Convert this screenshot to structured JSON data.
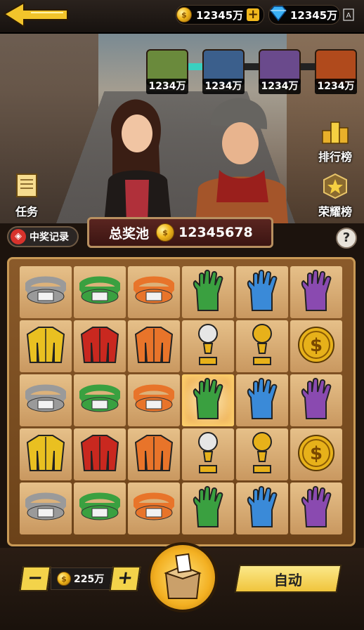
{
  "top_bar": {
    "coins": "12345万",
    "diamonds": "12345万"
  },
  "chests": [
    {
      "color": "#6a8a3c",
      "label": "1234万"
    },
    {
      "color": "#3b5f8c",
      "label": "1234万"
    },
    {
      "color": "#6a4a8c",
      "label": "1234万"
    },
    {
      "color": "#b04a1c",
      "label": "1234万"
    }
  ],
  "side_buttons": {
    "task": "任务",
    "ranking": "排行榜",
    "honor": "荣耀榜"
  },
  "prize": {
    "record_label": "中奖记录",
    "pool_label": "总奖池",
    "pool_value": "12345678",
    "help": "?"
  },
  "board": {
    "items": [
      [
        "gray-belt",
        "green-belt",
        "orange-belt",
        "green-glove",
        "blue-glove",
        "purple-glove"
      ],
      [
        "yellow-jacket",
        "red-jacket",
        "orange-jacket",
        "silver-trophy",
        "gold-trophy",
        "gold-coin"
      ],
      [
        "gray-belt",
        "green-belt",
        "orange-belt",
        "green-glove",
        "blue-glove",
        "purple-glove"
      ],
      [
        "yellow-jacket",
        "red-jacket",
        "orange-jacket",
        "silver-trophy",
        "gold-trophy",
        "gold-coin"
      ],
      [
        "gray-belt",
        "green-belt",
        "orange-belt",
        "green-glove",
        "blue-glove",
        "purple-glove"
      ]
    ],
    "highlighted": {
      "row": 2,
      "col": 3
    },
    "colors": {
      "gray": "#9a9a9a",
      "green": "#3aa040",
      "orange": "#e8742a",
      "blue": "#3a8ad8",
      "purple": "#8a4ab0",
      "yellow": "#e9c021",
      "red": "#c9281f",
      "gold": "#e7b11a"
    }
  },
  "controls": {
    "minus": "−",
    "plus": "+",
    "bet": "225万",
    "auto": "自动"
  }
}
